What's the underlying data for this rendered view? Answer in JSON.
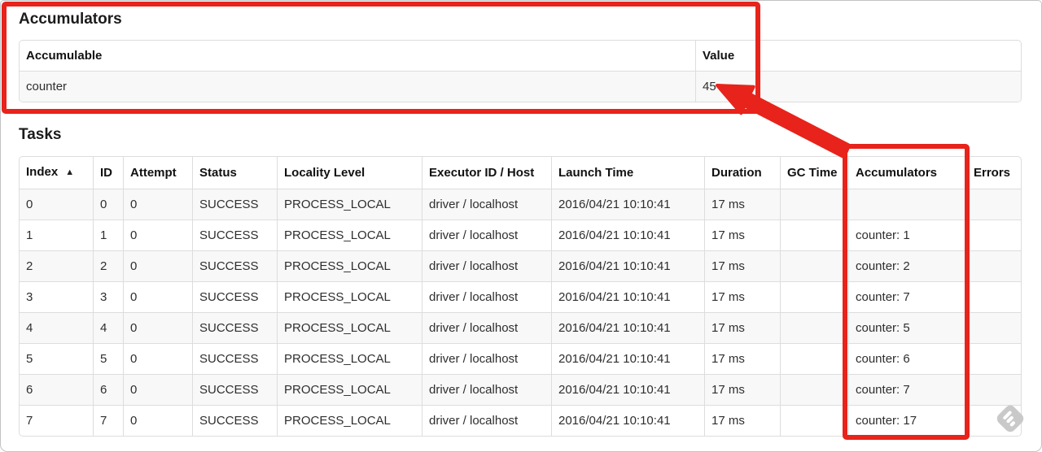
{
  "annotation": {
    "color": "#e7231b",
    "box1_name": "highlight-accumulators-section",
    "box2_name": "highlight-accumulators-column",
    "arrow_meaning": "points from tasks accumulators column to total value 45"
  },
  "accumulators_section": {
    "heading": "Accumulators",
    "table": {
      "columns": [
        "Accumulable",
        "Value"
      ],
      "rows": [
        [
          "counter",
          "45"
        ]
      ]
    }
  },
  "tasks_section": {
    "heading": "Tasks",
    "table": {
      "columns": [
        "Index",
        "ID",
        "Attempt",
        "Status",
        "Locality Level",
        "Executor ID / Host",
        "Launch Time",
        "Duration",
        "GC Time",
        "Accumulators",
        "Errors"
      ],
      "sort": {
        "column": "Index",
        "glyph": "▲",
        "direction": "ascending"
      },
      "rows": [
        [
          "0",
          "0",
          "0",
          "SUCCESS",
          "PROCESS_LOCAL",
          "driver / localhost",
          "2016/04/21 10:10:41",
          "17 ms",
          "",
          "",
          ""
        ],
        [
          "1",
          "1",
          "0",
          "SUCCESS",
          "PROCESS_LOCAL",
          "driver / localhost",
          "2016/04/21 10:10:41",
          "17 ms",
          "",
          "counter: 1",
          ""
        ],
        [
          "2",
          "2",
          "0",
          "SUCCESS",
          "PROCESS_LOCAL",
          "driver / localhost",
          "2016/04/21 10:10:41",
          "17 ms",
          "",
          "counter: 2",
          ""
        ],
        [
          "3",
          "3",
          "0",
          "SUCCESS",
          "PROCESS_LOCAL",
          "driver / localhost",
          "2016/04/21 10:10:41",
          "17 ms",
          "",
          "counter: 7",
          ""
        ],
        [
          "4",
          "4",
          "0",
          "SUCCESS",
          "PROCESS_LOCAL",
          "driver / localhost",
          "2016/04/21 10:10:41",
          "17 ms",
          "",
          "counter: 5",
          ""
        ],
        [
          "5",
          "5",
          "0",
          "SUCCESS",
          "PROCESS_LOCAL",
          "driver / localhost",
          "2016/04/21 10:10:41",
          "17 ms",
          "",
          "counter: 6",
          ""
        ],
        [
          "6",
          "6",
          "0",
          "SUCCESS",
          "PROCESS_LOCAL",
          "driver / localhost",
          "2016/04/21 10:10:41",
          "17 ms",
          "",
          "counter: 7",
          ""
        ],
        [
          "7",
          "7",
          "0",
          "SUCCESS",
          "PROCESS_LOCAL",
          "driver / localhost",
          "2016/04/21 10:10:41",
          "17 ms",
          "",
          "counter: 17",
          ""
        ]
      ]
    }
  },
  "watermark": {
    "name": "feedly-logo",
    "color": "#c9c9c9"
  }
}
